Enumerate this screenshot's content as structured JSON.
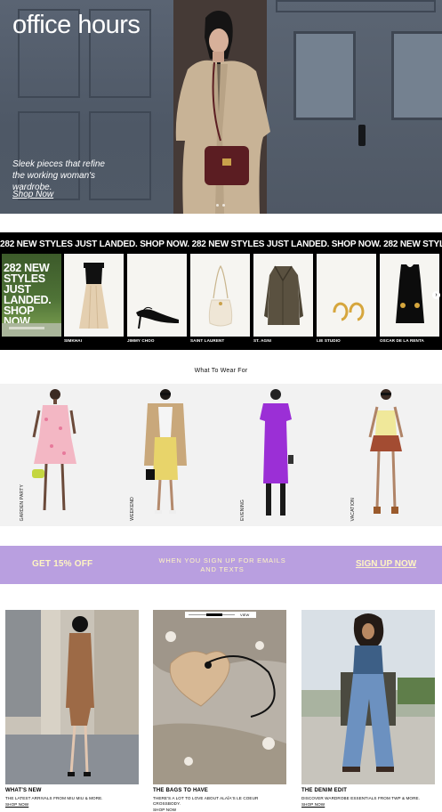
{
  "hero": {
    "title": "office hours",
    "subtitle": "Sleek pieces that refine the working woman's wardrobe.",
    "cta": "Shop Now"
  },
  "new_arrivals": {
    "marquee": "282 NEW STYLES JUST LANDED. SHOP NOW. 282 NEW STYLES JUST LANDED. SHOP NOW. 282 NEW STYLES JUST LANDED. SHOP NOW.",
    "promo": "282 NEW STYLES JUST LANDED. SHOP NOW.",
    "products": [
      {
        "brand": "SIMKHAI",
        "icon": "dress-icon"
      },
      {
        "brand": "JIMMY CHOO",
        "icon": "shoe-icon"
      },
      {
        "brand": "SAINT LAURENT",
        "icon": "bag-icon"
      },
      {
        "brand": "ST. AGNI",
        "icon": "coat-icon"
      },
      {
        "brand": "LIE STUDIO",
        "icon": "earrings-icon"
      },
      {
        "brand": "OSCAR DE LA RENTA",
        "icon": "dress-icon"
      }
    ]
  },
  "what_to_wear": {
    "title": "What To Wear For",
    "looks": [
      {
        "label": "GARDEN PARTY"
      },
      {
        "label": "WEEKEND"
      },
      {
        "label": "EVENING"
      },
      {
        "label": "VACATION"
      }
    ]
  },
  "signup": {
    "offer": "GET 15% OFF",
    "message": "WHEN YOU SIGN UP FOR EMAILS AND TEXTS",
    "cta": "SIGN UP NOW"
  },
  "editorial": {
    "view_label": "VIEW",
    "cards": [
      {
        "title": "WHAT'S NEW",
        "desc": "THE LATEST ARRIVALS FROM MIU MIU & MORE.",
        "link": "SHOP NOW"
      },
      {
        "title": "THE BAGS TO HAVE",
        "desc": "THERE'S A LOT TO LOVE ABOUT ALAÏA'S LE COEUR CROSSBODY.",
        "link": "SHOP NOW"
      },
      {
        "title": "THE DENIM EDIT",
        "desc": "DISCOVER WARDROBE ESSENTIALS FROM TWP & MORE.",
        "link": "SHOP NOW"
      }
    ]
  },
  "colors": {
    "signup_bg": "#b99fe0",
    "signup_text": "#fff5c2",
    "band_bg": "#000000"
  }
}
